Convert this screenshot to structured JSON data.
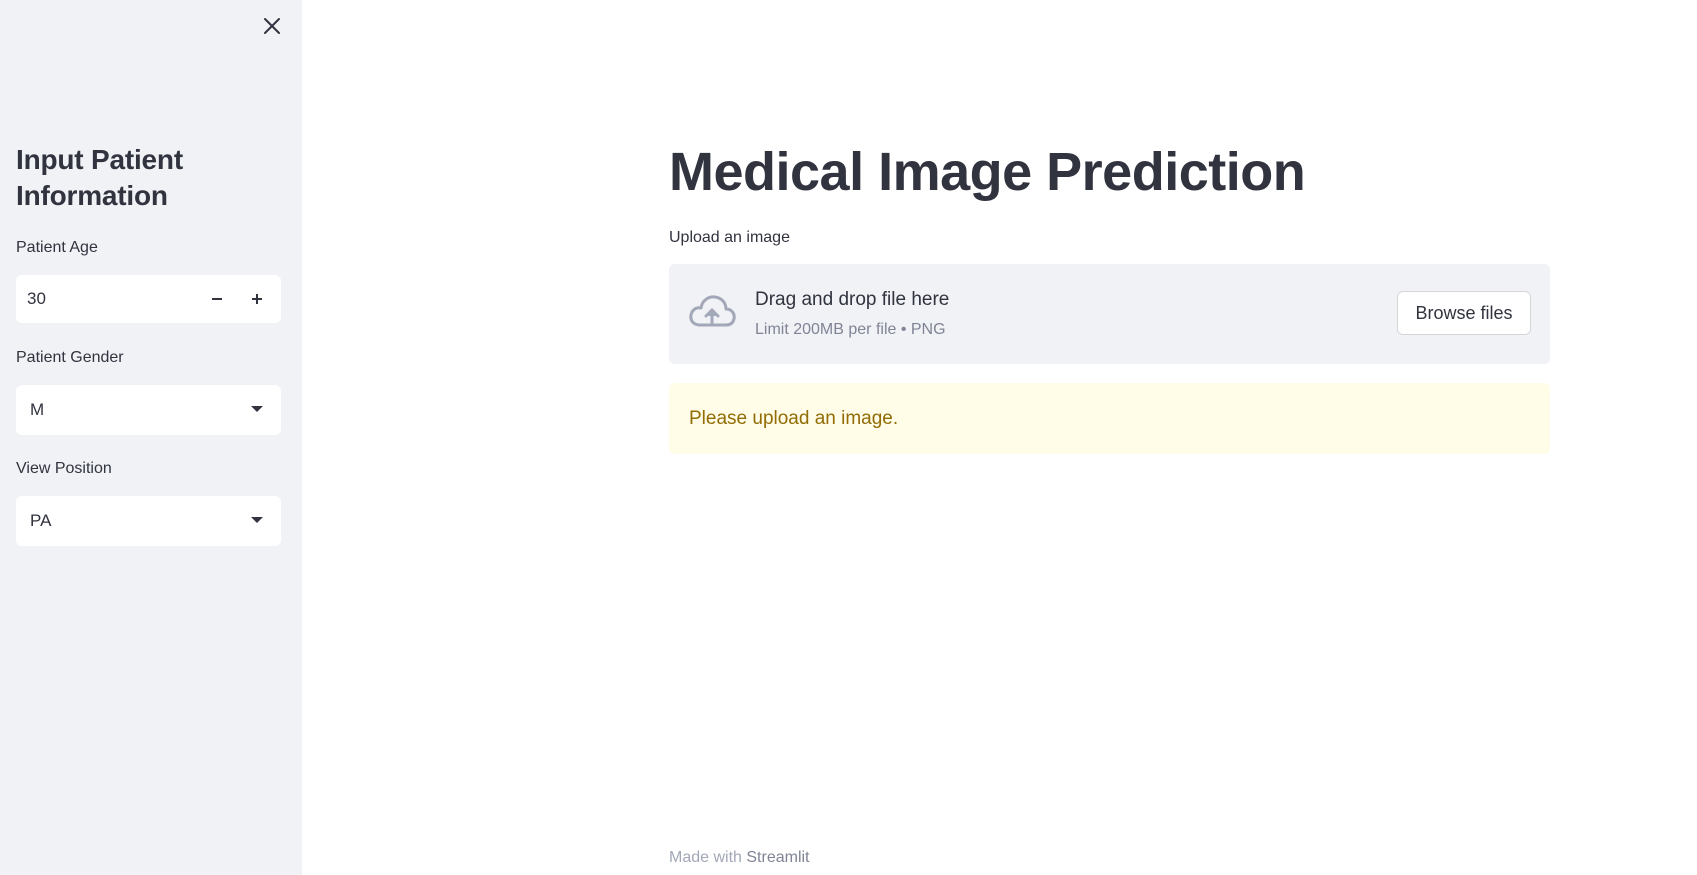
{
  "sidebar": {
    "heading": "Input Patient Information",
    "age": {
      "label": "Patient Age",
      "value": "30"
    },
    "gender": {
      "label": "Patient Gender",
      "value": "M"
    },
    "view_position": {
      "label": "View Position",
      "value": "PA"
    }
  },
  "main": {
    "title": "Medical Image Prediction",
    "uploader": {
      "label": "Upload an image",
      "drag_text": "Drag and drop file here",
      "limit_text": "Limit 200MB per file • PNG",
      "browse_label": "Browse files"
    },
    "warning": "Please upload an image."
  },
  "footer": {
    "prefix": "Made with",
    "link": "Streamlit"
  },
  "icons": {
    "close": "close-icon",
    "minus": "minus-icon",
    "plus": "plus-icon",
    "caret": "chevron-down-icon",
    "upload": "cloud-upload-icon"
  },
  "colors": {
    "sidebar_bg": "#f0f2f6",
    "text": "#31333f",
    "warning_bg": "#fffce7",
    "warning_text": "#926c05",
    "muted": "#808495"
  }
}
